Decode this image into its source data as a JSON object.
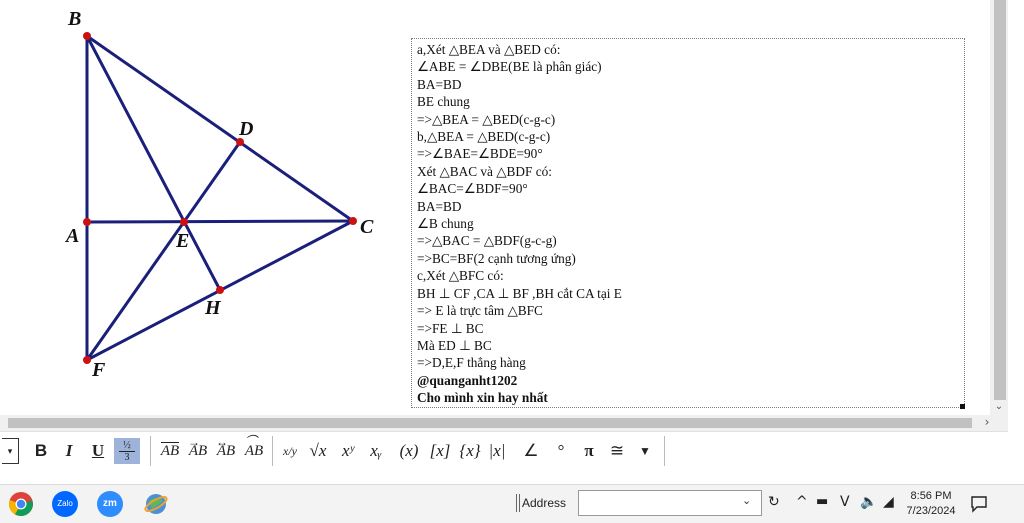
{
  "figure": {
    "points": {
      "B": "B",
      "D": "D",
      "A": "A",
      "E": "E",
      "C": "C",
      "H": "H",
      "F": "F"
    }
  },
  "solution": {
    "lines": [
      "a,Xét △BEA và △BED có:",
      "∠ABE = ∠DBE(BE là phân giác)",
      "BA=BD",
      "BE chung",
      "=>△BEA = △BED(c-g-c)",
      "b,△BEA = △BED(c-g-c)",
      "=>∠BAE=∠BDE=90°",
      "Xét △BAC và △BDF có:",
      "∠BAC=∠BDF=90°",
      "BA=BD",
      "∠B chung",
      "=>△BAC = △BDF(g-c-g)",
      "=>BC=BF(2 cạnh tương ứng)",
      "c,Xét △BFC có:",
      "BH ⊥ CF  ,CA ⊥ BF  ,BH cắt CA tại E",
      "=> E là trực tâm △BFC",
      "=>FE ⊥ BC",
      "Mà ED ⊥ BC",
      "=>D,E,F thẳng hàng"
    ],
    "bold_lines": [
      "@quanganht1202",
      "Cho mình xin hay nhất"
    ]
  },
  "toolbar": {
    "bold": "B",
    "italic": "I",
    "underline": "U",
    "fraction_num": "½",
    "fraction_den": "3",
    "seg": "AB",
    "frac": "x/y",
    "sqrt": "√x",
    "sup": "xʸ",
    "sub": "xᵧ",
    "paren": "(x)",
    "bracket": "[x]",
    "brace": "{x}",
    "abs": "|x|",
    "angle": "∠",
    "degree": "°",
    "pi": "π",
    "congruent": "≅",
    "more": "▼"
  },
  "taskbar": {
    "address_label": "Address",
    "time": "8:56 PM",
    "date": "7/23/2024",
    "zalo_label": "Zalo",
    "zoom_label": "zm"
  },
  "colors": {
    "line": "#1a1f7a",
    "point": "#cc1111"
  }
}
